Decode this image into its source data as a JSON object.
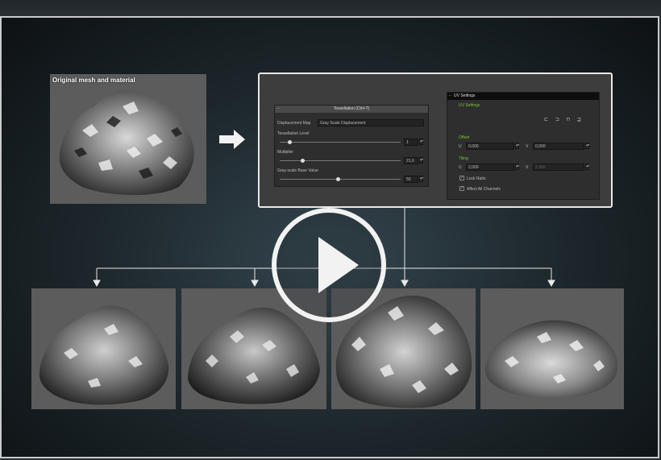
{
  "original": {
    "caption": "Original mesh and material"
  },
  "tessellation": {
    "header": "Tessellation (Ctrl+T)",
    "displacement_map_label": "Displacement Map",
    "displacement_map_value": "Gray Scale Displacement",
    "level_label": "Tessellation Level",
    "level_value": "1",
    "multiplier_label": "Multiplier",
    "multiplier_value": "21,0",
    "base_label": "Gray-scale Base Value",
    "base_value": "50"
  },
  "uv": {
    "header": "UV Settings",
    "section": "UV Settings",
    "offset_label": "Offset",
    "tiling_label": "Tiling",
    "offset_u": "0,000",
    "offset_v": "0,000",
    "tiling_u": "2,000",
    "tiling_v": "2,000",
    "u_label": "U",
    "v_label": "V",
    "lock_ratio": "Lock Ratio",
    "affect_all": "Affect All Channels"
  },
  "colors": {
    "accent_green": "#7fc43a",
    "panel": "#3d3d3d"
  }
}
